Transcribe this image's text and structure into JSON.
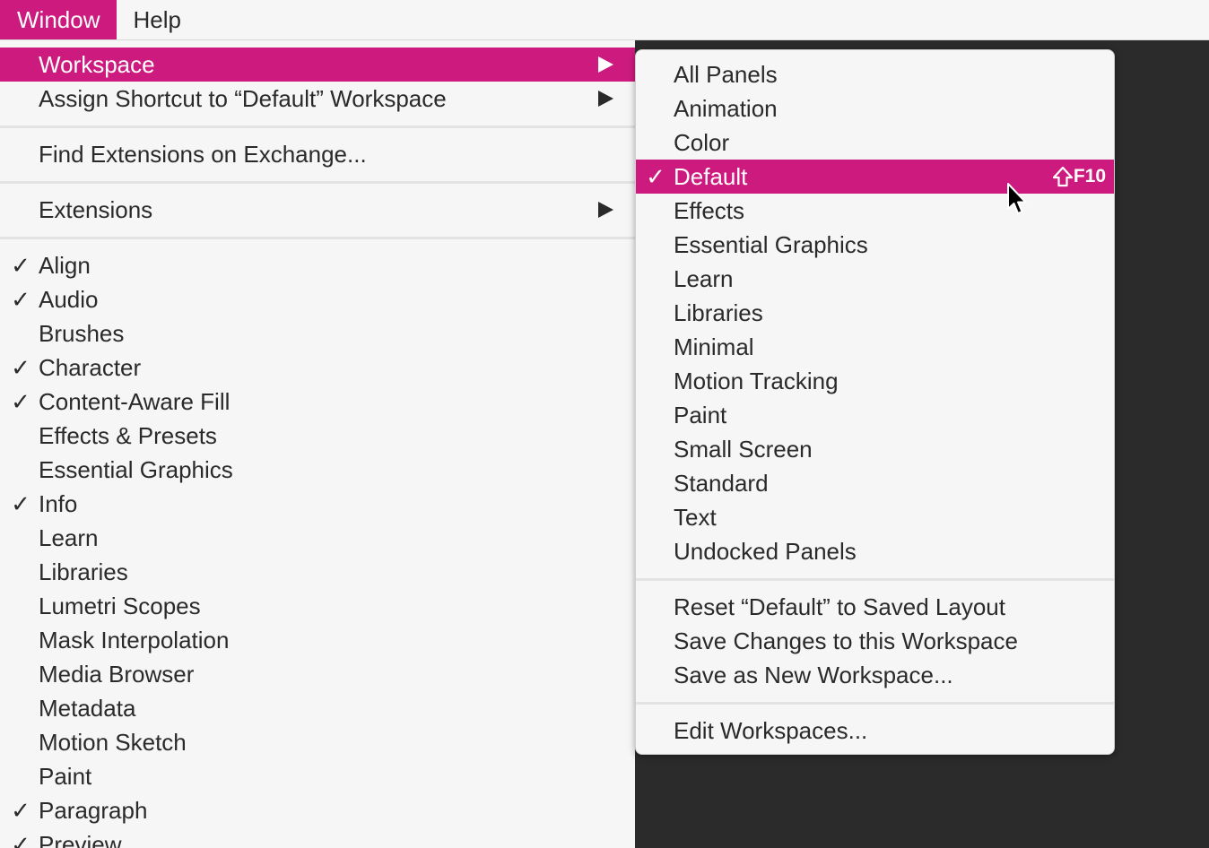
{
  "menubar": {
    "window_label": "Window",
    "help_label": "Help"
  },
  "main_menu": {
    "workspace_label": "Workspace",
    "assign_shortcut_label": "Assign Shortcut to “Default” Workspace",
    "find_extensions_label": "Find Extensions on Exchange...",
    "extensions_label": "Extensions",
    "panels": [
      {
        "label": "Align",
        "check": "✓"
      },
      {
        "label": "Audio",
        "check": "✓"
      },
      {
        "label": "Brushes",
        "check": ""
      },
      {
        "label": "Character",
        "check": "✓"
      },
      {
        "label": "Content-Aware Fill",
        "check": "✓"
      },
      {
        "label": "Effects & Presets",
        "check": ""
      },
      {
        "label": "Essential Graphics",
        "check": ""
      },
      {
        "label": "Info",
        "check": "✓"
      },
      {
        "label": "Learn",
        "check": ""
      },
      {
        "label": "Libraries",
        "check": ""
      },
      {
        "label": "Lumetri Scopes",
        "check": ""
      },
      {
        "label": "Mask Interpolation",
        "check": ""
      },
      {
        "label": "Media Browser",
        "check": ""
      },
      {
        "label": "Metadata",
        "check": ""
      },
      {
        "label": "Motion Sketch",
        "check": ""
      },
      {
        "label": "Paint",
        "check": ""
      },
      {
        "label": "Paragraph",
        "check": "✓"
      },
      {
        "label": "Preview",
        "check": "✓"
      }
    ]
  },
  "workspace_submenu": {
    "items": [
      {
        "label": "All Panels",
        "check": ""
      },
      {
        "label": "Animation",
        "check": ""
      },
      {
        "label": "Color",
        "check": ""
      },
      {
        "label": "Default",
        "check": "✓"
      },
      {
        "label": "Effects",
        "check": ""
      },
      {
        "label": "Essential Graphics",
        "check": ""
      },
      {
        "label": "Learn",
        "check": ""
      },
      {
        "label": "Libraries",
        "check": ""
      },
      {
        "label": "Minimal",
        "check": ""
      },
      {
        "label": "Motion Tracking",
        "check": ""
      },
      {
        "label": "Paint",
        "check": ""
      },
      {
        "label": "Small Screen",
        "check": ""
      },
      {
        "label": "Standard",
        "check": ""
      },
      {
        "label": "Text",
        "check": ""
      },
      {
        "label": "Undocked Panels",
        "check": ""
      }
    ],
    "default_shortcut_key": "F10",
    "reset_label": "Reset “Default” to Saved Layout",
    "save_changes_label": "Save Changes to this Workspace",
    "save_new_label": "Save as New Workspace...",
    "edit_label": "Edit Workspaces..."
  },
  "colors": {
    "accent": "#cd1a7e",
    "menu_bg": "#f6f6f6",
    "app_bg": "#2b2b2b"
  },
  "icons": {
    "submenu_arrow": "triangle-right-icon",
    "checkmark": "checkmark-icon",
    "shift_key": "shift-key-icon",
    "cursor": "mouse-pointer-icon"
  }
}
